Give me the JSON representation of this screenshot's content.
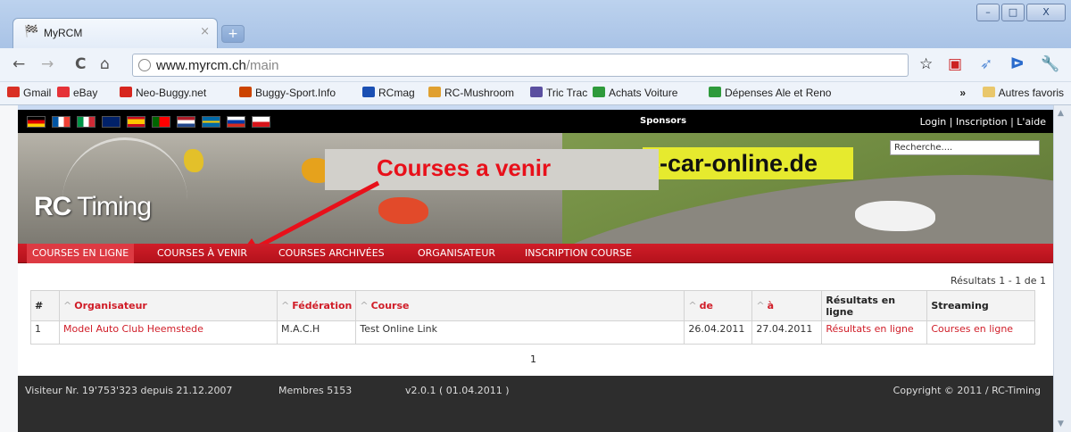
{
  "browser": {
    "tab_title": "MyRCM",
    "tab_close": "×",
    "new_tab": "+",
    "url_host": "www.myrcm.ch",
    "url_path": "/main",
    "window_buttons": [
      "–",
      "□",
      "X"
    ],
    "bookmarks": [
      {
        "label": "Gmail",
        "color": "#d93025"
      },
      {
        "label": "eBay",
        "color": "#e53238"
      },
      {
        "label": "Neo-Buggy.net",
        "color": "#d7261e"
      },
      {
        "label": "Buggy-Sport.Info",
        "color": "#cc4400"
      },
      {
        "label": "RCmag",
        "color": "#1a4fb3"
      },
      {
        "label": "RC-Mushroom",
        "color": "#e0a030"
      },
      {
        "label": "Tric Trac",
        "color": "#5a4fa0"
      },
      {
        "label": "Achats Voiture",
        "color": "#2e9a3b"
      },
      {
        "label": "Dépenses Ale et Reno",
        "color": "#2e9a3b"
      }
    ],
    "bookmarks_overflow": "»",
    "other_bookmarks": "Autres favoris"
  },
  "site": {
    "sponsors_label": "Sponsors",
    "login_links": "Login | Inscription | L'aide",
    "logo_bold": "RC",
    "logo_light": " Timing",
    "sponsor_ad": "c-car-online.de",
    "search_placeholder": "Recherche....",
    "annotation": "Courses a venir",
    "nav": [
      "COURSES EN LIGNE",
      "COURSES À VENIR",
      "COURSES ARCHIVÉES",
      "ORGANISATEUR",
      "INSCRIPTION COURSE"
    ],
    "results_count": "Résultats 1 - 1 de 1",
    "table": {
      "headers": {
        "num": "#",
        "organizer": "Organisateur",
        "federation": "Fédération",
        "course": "Course",
        "from": "de",
        "to": "à",
        "results": "Résultats en ligne",
        "streaming": "Streaming"
      },
      "rows": [
        {
          "num": "1",
          "organizer": "Model Auto Club Heemstede",
          "federation": "M.A.C.H",
          "course": "Test Online Link",
          "from": "26.04.2011",
          "to": "27.04.2011",
          "results": "Résultats en ligne",
          "streaming": "Courses en ligne"
        }
      ]
    },
    "pager": "1",
    "footer": {
      "visitors": "Visiteur Nr. 19'753'323 depuis 21.12.2007",
      "members": "Membres 5153",
      "version": "v2.0.1 ( 01.04.2011 )",
      "copyright": "Copyright © 2011 / RC-Timing"
    },
    "colors": {
      "accent": "#d01d28",
      "ad": "#e6ea2e",
      "annotation_text": "#e8101a"
    }
  }
}
